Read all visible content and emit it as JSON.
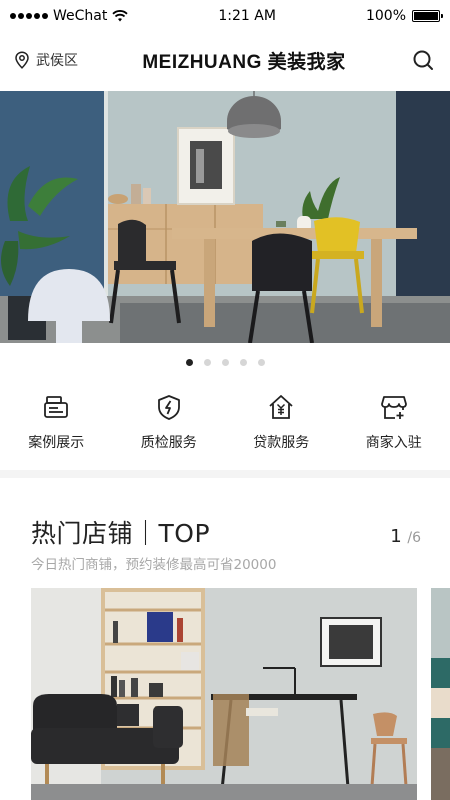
{
  "status_bar": {
    "carrier": "WeChat",
    "time": "1:21 AM",
    "battery_text": "100%",
    "battery_level": 1.0
  },
  "header": {
    "location": "武侯区",
    "brand": "MEIZHUANG 美装我家",
    "search_icon": "search-icon"
  },
  "banner": {
    "slide_count": 5,
    "active_index": 0
  },
  "quick_menu": [
    {
      "label": "案例展示",
      "icon": "case-showcase-icon"
    },
    {
      "label": "质检服务",
      "icon": "quality-shield-icon"
    },
    {
      "label": "贷款服务",
      "icon": "loan-house-icon"
    },
    {
      "label": "商家入驻",
      "icon": "merchant-store-icon"
    }
  ],
  "hot_shops": {
    "title": "热门店铺｜TOP",
    "current_page": "1",
    "total_pages": "/6",
    "subtitle": "今日热门商铺，预约装修最高可省20000"
  },
  "colors": {
    "accent": "#222222",
    "muted": "#a8a8a8",
    "divider": "#f4f4f4"
  }
}
